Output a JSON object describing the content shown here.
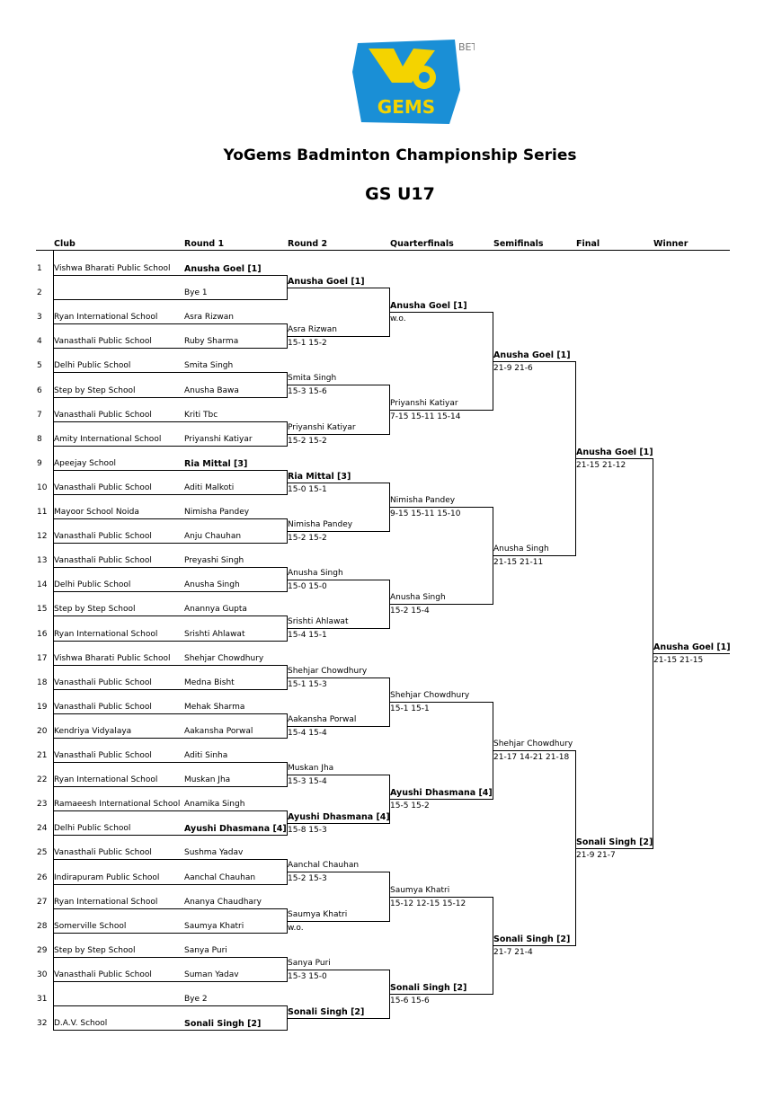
{
  "logo": {
    "badge": "BETA",
    "mark": "Yo",
    "word": "GEMS"
  },
  "title": "YoGems Badminton Championship Series",
  "subtitle": "GS U17",
  "headers": [
    "Club",
    "Round 1",
    "Round 2",
    "Quarterfinals",
    "Semifinals",
    "Final",
    "Winner"
  ],
  "entries": [
    {
      "seed": "1",
      "club": "Vishwa Bharati Public School",
      "player": "Anusha Goel [1]",
      "bold": true
    },
    {
      "seed": "2",
      "club": "",
      "player": "Bye 1",
      "bold": false
    },
    {
      "seed": "3",
      "club": "Ryan International School",
      "player": "Asra Rizwan",
      "bold": false
    },
    {
      "seed": "4",
      "club": "Vanasthali Public School",
      "player": "Ruby Sharma",
      "bold": false
    },
    {
      "seed": "5",
      "club": "Delhi Public School",
      "player": "Smita Singh",
      "bold": false
    },
    {
      "seed": "6",
      "club": "Step by Step School",
      "player": "Anusha Bawa",
      "bold": false
    },
    {
      "seed": "7",
      "club": "Vanasthali Public School",
      "player": "Kriti Tbc",
      "bold": false
    },
    {
      "seed": "8",
      "club": "Amity International School",
      "player": "Priyanshi Katiyar",
      "bold": false
    },
    {
      "seed": "9",
      "club": "Apeejay School",
      "player": "Ria Mittal [3]",
      "bold": true
    },
    {
      "seed": "10",
      "club": "Vanasthali Public School",
      "player": "Aditi Malkoti",
      "bold": false
    },
    {
      "seed": "11",
      "club": "Mayoor School Noida",
      "player": "Nimisha Pandey",
      "bold": false
    },
    {
      "seed": "12",
      "club": "Vanasthali Public School",
      "player": "Anju Chauhan",
      "bold": false
    },
    {
      "seed": "13",
      "club": "Vanasthali Public School",
      "player": "Preyashi Singh",
      "bold": false
    },
    {
      "seed": "14",
      "club": "Delhi Public School",
      "player": "Anusha Singh",
      "bold": false
    },
    {
      "seed": "15",
      "club": "Step by Step School",
      "player": "Anannya Gupta",
      "bold": false
    },
    {
      "seed": "16",
      "club": "Ryan International School",
      "player": "Srishti Ahlawat",
      "bold": false
    },
    {
      "seed": "17",
      "club": "Vishwa Bharati Public School",
      "player": "Shehjar Chowdhury",
      "bold": false
    },
    {
      "seed": "18",
      "club": "Vanasthali Public School",
      "player": "Medna Bisht",
      "bold": false
    },
    {
      "seed": "19",
      "club": "Vanasthali Public School",
      "player": "Mehak Sharma",
      "bold": false
    },
    {
      "seed": "20",
      "club": "Kendriya Vidyalaya",
      "player": "Aakansha Porwal",
      "bold": false
    },
    {
      "seed": "21",
      "club": "Vanasthali Public School",
      "player": "Aditi Sinha",
      "bold": false
    },
    {
      "seed": "22",
      "club": "Ryan International School",
      "player": "Muskan Jha",
      "bold": false
    },
    {
      "seed": "23",
      "club": "Ramaeesh International School",
      "player": "Anamika Singh",
      "bold": false
    },
    {
      "seed": "24",
      "club": "Delhi Public School",
      "player": "Ayushi Dhasmana [4]",
      "bold": true
    },
    {
      "seed": "25",
      "club": "Vanasthali Public School",
      "player": "Sushma Yadav",
      "bold": false
    },
    {
      "seed": "26",
      "club": "Indirapuram Public School",
      "player": "Aanchal Chauhan",
      "bold": false
    },
    {
      "seed": "27",
      "club": "Ryan International School",
      "player": "Ananya Chaudhary",
      "bold": false
    },
    {
      "seed": "28",
      "club": "Somerville School",
      "player": "Saumya Khatri",
      "bold": false
    },
    {
      "seed": "29",
      "club": "Step by Step School",
      "player": "Sanya Puri",
      "bold": false
    },
    {
      "seed": "30",
      "club": "Vanasthali Public School",
      "player": "Suman Yadav",
      "bold": false
    },
    {
      "seed": "31",
      "club": "",
      "player": "Bye 2",
      "bold": false
    },
    {
      "seed": "32",
      "club": "D.A.V. School",
      "player": "Sonali Singh [2]",
      "bold": true
    }
  ],
  "rounds": [
    [
      {
        "name": "Anusha Goel [1]",
        "score": "",
        "bold": true
      },
      {
        "name": "Asra Rizwan",
        "score": "15-1 15-2",
        "bold": false
      },
      {
        "name": "Smita Singh",
        "score": "15-3 15-6",
        "bold": false
      },
      {
        "name": "Priyanshi Katiyar",
        "score": "15-2 15-2",
        "bold": false
      },
      {
        "name": "Ria Mittal [3]",
        "score": "15-0 15-1",
        "bold": true
      },
      {
        "name": "Nimisha Pandey",
        "score": "15-2 15-2",
        "bold": false
      },
      {
        "name": "Anusha Singh",
        "score": "15-0 15-0",
        "bold": false
      },
      {
        "name": "Srishti Ahlawat",
        "score": "15-4 15-1",
        "bold": false
      },
      {
        "name": "Shehjar Chowdhury",
        "score": "15-1 15-3",
        "bold": false
      },
      {
        "name": "Aakansha Porwal",
        "score": "15-4 15-4",
        "bold": false
      },
      {
        "name": "Muskan Jha",
        "score": "15-3 15-4",
        "bold": false
      },
      {
        "name": "Ayushi Dhasmana [4]",
        "score": "15-8 15-3",
        "bold": true
      },
      {
        "name": "Aanchal Chauhan",
        "score": "15-2 15-3",
        "bold": false
      },
      {
        "name": "Saumya Khatri",
        "score": "w.o.",
        "bold": false
      },
      {
        "name": "Sanya Puri",
        "score": "15-3 15-0",
        "bold": false
      },
      {
        "name": "Sonali Singh [2]",
        "score": "",
        "bold": true
      }
    ],
    [
      {
        "name": "Anusha Goel [1]",
        "score": "w.o.",
        "bold": true
      },
      {
        "name": "Priyanshi Katiyar",
        "score": "7-15 15-11 15-14",
        "bold": false
      },
      {
        "name": "Nimisha Pandey",
        "score": "9-15 15-11 15-10",
        "bold": false
      },
      {
        "name": "Anusha Singh",
        "score": "15-2 15-4",
        "bold": false
      },
      {
        "name": "Shehjar Chowdhury",
        "score": "15-1 15-1",
        "bold": false
      },
      {
        "name": "Ayushi Dhasmana [4]",
        "score": "15-5 15-2",
        "bold": true
      },
      {
        "name": "Saumya Khatri",
        "score": "15-12 12-15 15-12",
        "bold": false
      },
      {
        "name": "Sonali Singh [2]",
        "score": "15-6 15-6",
        "bold": true
      }
    ],
    [
      {
        "name": "Anusha Goel [1]",
        "score": "21-9 21-6",
        "bold": true
      },
      {
        "name": "Anusha Singh",
        "score": "21-15 21-11",
        "bold": false
      },
      {
        "name": "Shehjar Chowdhury",
        "score": "21-17 14-21 21-18",
        "bold": false
      },
      {
        "name": "Sonali Singh [2]",
        "score": "21-7 21-4",
        "bold": true
      }
    ],
    [
      {
        "name": "Anusha Goel [1]",
        "score": "21-15 21-12",
        "bold": true
      },
      {
        "name": "Sonali Singh [2]",
        "score": "21-9 21-7",
        "bold": true
      }
    ],
    [
      {
        "name": "Anusha Goel [1]",
        "score": "21-15 21-15",
        "bold": true
      }
    ]
  ]
}
